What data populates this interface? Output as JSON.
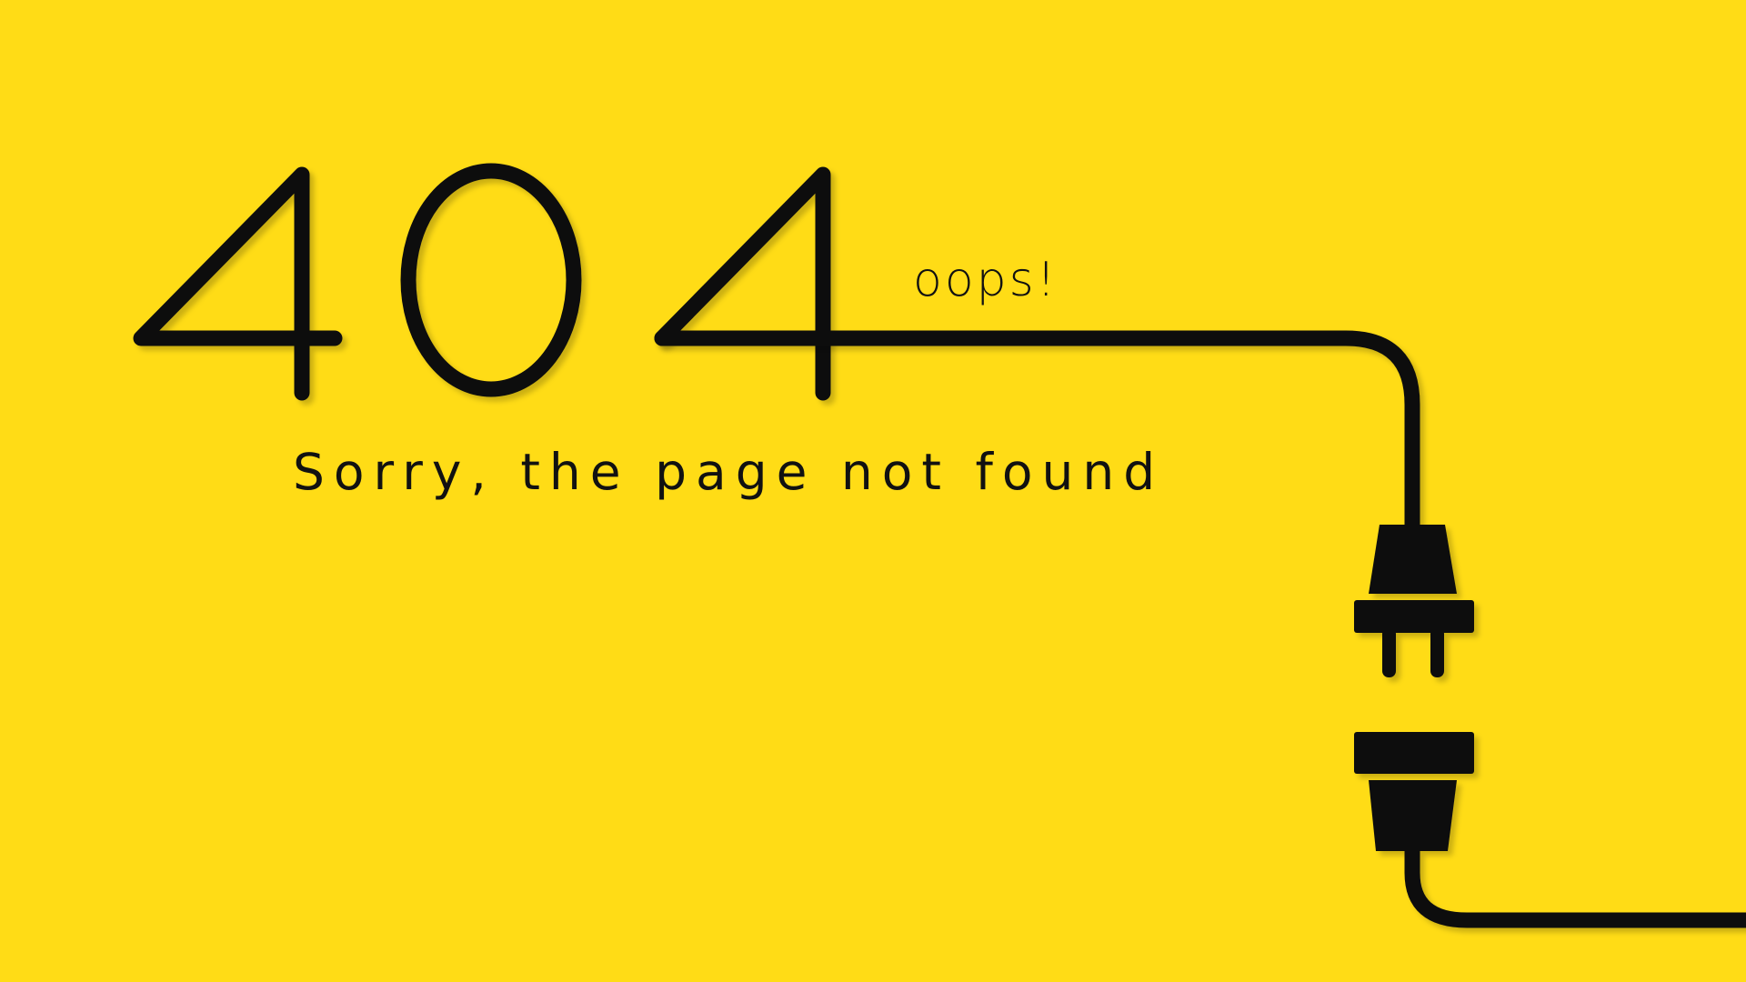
{
  "page": {
    "background_color": "#FFDC16",
    "ink_color": "#111111",
    "error_code": "404",
    "exclamation": "oops!",
    "message": "Sorry, the page not found"
  },
  "illustration": {
    "icon": "unplugged-power-cord-icon"
  }
}
